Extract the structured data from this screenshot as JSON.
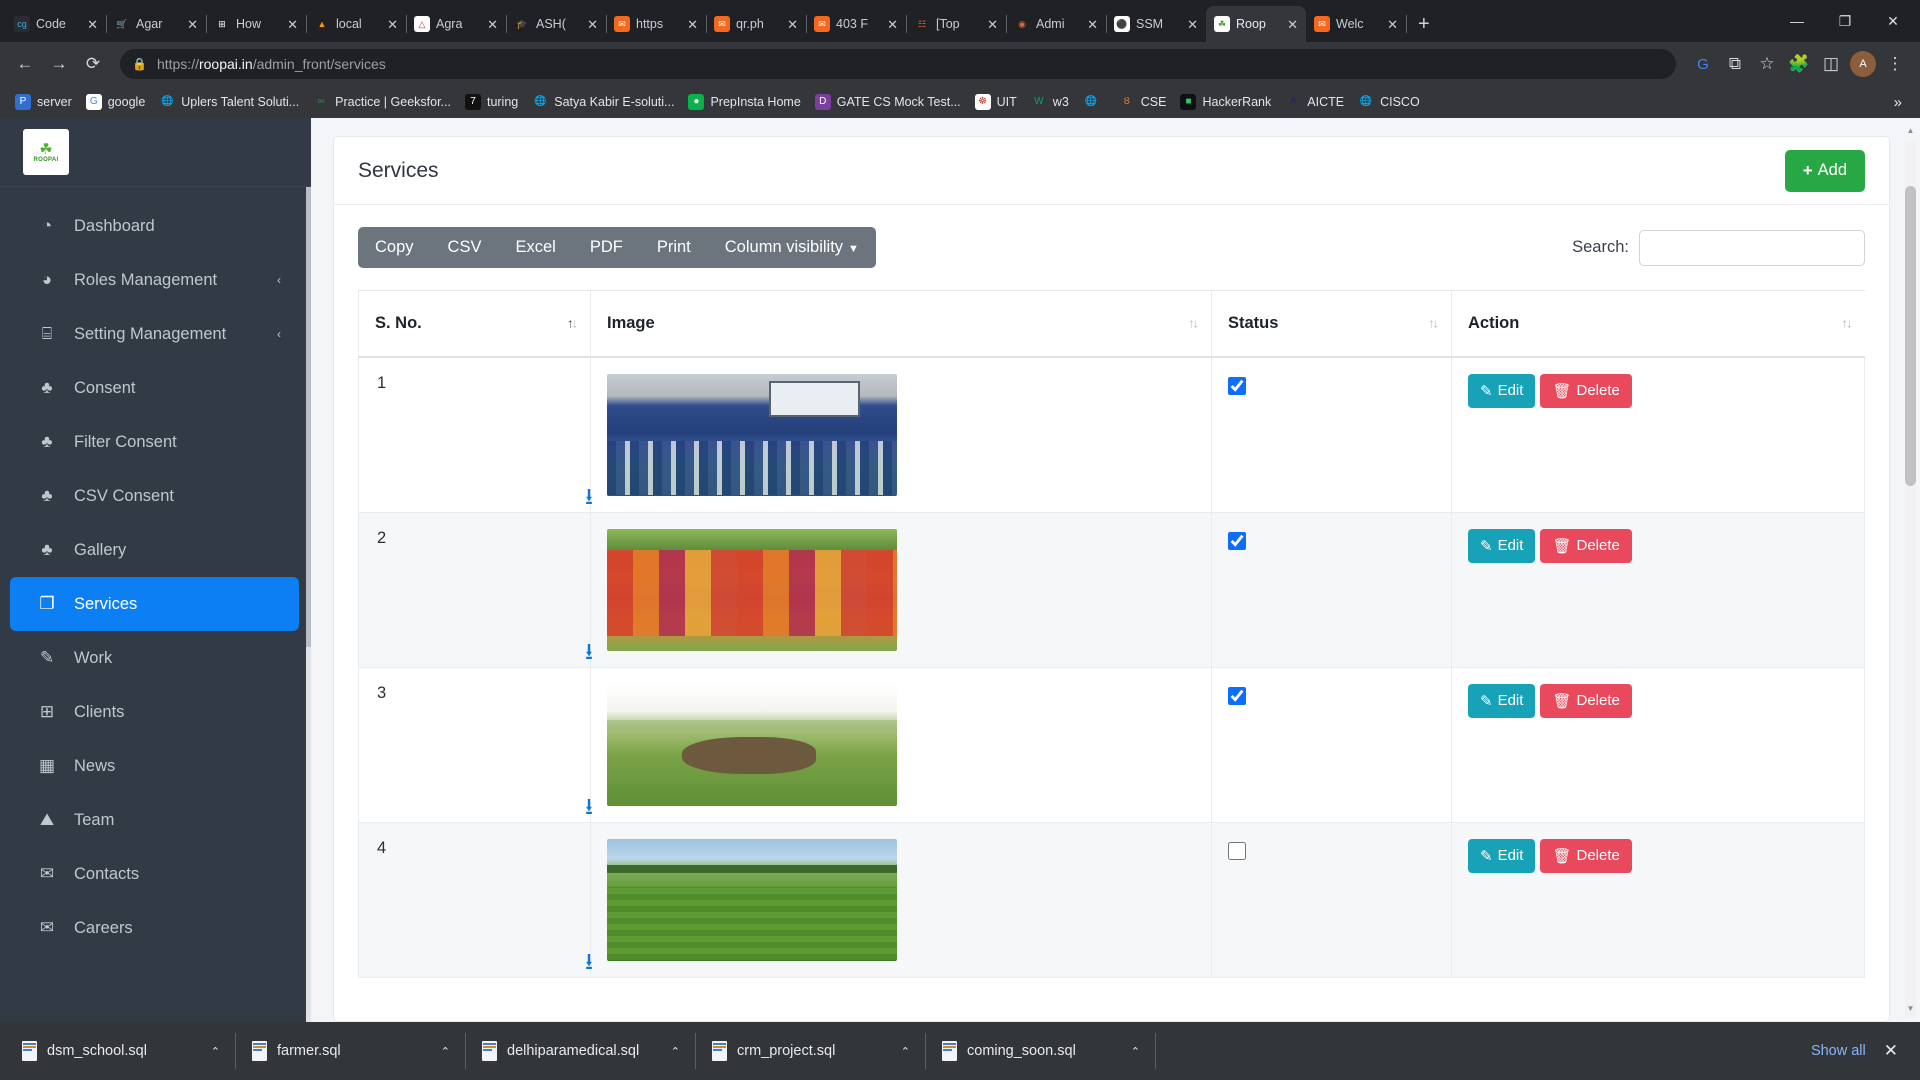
{
  "browser": {
    "tabs": [
      {
        "label": "Code",
        "icon": "cg-icon",
        "active": false
      },
      {
        "label": "Agar",
        "icon": "cart-icon",
        "active": false
      },
      {
        "label": "How",
        "icon": "microsoft-icon",
        "active": false
      },
      {
        "label": "local",
        "icon": "pma-icon",
        "active": false
      },
      {
        "label": "Agra",
        "icon": "agra-icon",
        "active": false
      },
      {
        "label": "ASH(",
        "icon": "graduation-cap-icon",
        "active": false
      },
      {
        "label": "https",
        "icon": "xampp-icon",
        "active": false
      },
      {
        "label": "qr.ph",
        "icon": "xampp-icon",
        "active": false
      },
      {
        "label": "403 F",
        "icon": "xampp-icon",
        "active": false
      },
      {
        "label": "[Top",
        "icon": "polrici-icon",
        "active": false
      },
      {
        "label": "Admi",
        "icon": "chrome-icon",
        "active": false
      },
      {
        "label": "SSM",
        "icon": "ssm-icon",
        "active": false
      },
      {
        "label": "Roop",
        "icon": "roopai-icon",
        "active": true
      },
      {
        "label": "Welc",
        "icon": "xampp-icon",
        "active": false
      }
    ],
    "new_tab_label": "+",
    "window_controls": {
      "minimize": "—",
      "maximize": "❐",
      "close": "✕"
    },
    "nav": {
      "back": "←",
      "forward": "→",
      "reload": "⟳",
      "lock_icon": "lock-icon"
    },
    "url": {
      "scheme": "https://",
      "host": "roopai.in",
      "path": "/admin_front/services"
    },
    "right_icons": [
      "google-g-icon",
      "share-icon",
      "bookmark-star-icon",
      "extensions-puzzle-icon",
      "sidepanel-icon",
      "profile-avatar",
      "kebab-menu-icon"
    ],
    "profile_initial": "A",
    "bookmarks": [
      {
        "label": "server",
        "icon": "p-icon"
      },
      {
        "label": "google",
        "icon": "google-g-icon"
      },
      {
        "label": "Uplers Talent Soluti...",
        "icon": "globe-icon"
      },
      {
        "label": "Practice | Geeksfor...",
        "icon": "geeksforgeeks-icon"
      },
      {
        "label": "turing",
        "icon": "turing-icon"
      },
      {
        "label": "Satya Kabir E-soluti...",
        "icon": "globe-icon"
      },
      {
        "label": "PrepInsta Home",
        "icon": "prepinsta-icon"
      },
      {
        "label": "GATE CS Mock Test...",
        "icon": "gate-icon"
      },
      {
        "label": "UIT",
        "icon": "uit-icon"
      },
      {
        "label": "w3",
        "icon": "w3schools-icon"
      },
      {
        "label": "",
        "icon": "globe-icon"
      },
      {
        "label": "CSE",
        "icon": "cse-icon"
      },
      {
        "label": "HackerRank",
        "icon": "hackerrank-icon"
      },
      {
        "label": "AICTE",
        "icon": "aicte-icon"
      },
      {
        "label": "CISCO",
        "icon": "globe-icon"
      }
    ],
    "bookmarks_overflow": "»"
  },
  "sidebar": {
    "brand": {
      "mark": "☘",
      "text": "ROOPAI"
    },
    "items": [
      {
        "label": "Dashboard",
        "icon": "dashboard-gauge-icon",
        "caret": "",
        "active": false
      },
      {
        "label": "Roles Management",
        "icon": "pie-chart-icon",
        "caret": "‹",
        "active": false
      },
      {
        "label": "Setting Management",
        "icon": "grid-icon",
        "caret": "‹",
        "active": false
      },
      {
        "label": "Consent",
        "icon": "tree-icon",
        "caret": "",
        "active": false
      },
      {
        "label": "Filter Consent",
        "icon": "tree-icon",
        "caret": "",
        "active": false
      },
      {
        "label": "CSV Consent",
        "icon": "tree-icon",
        "caret": "",
        "active": false
      },
      {
        "label": "Gallery",
        "icon": "tree-icon",
        "caret": "",
        "active": false
      },
      {
        "label": "Services",
        "icon": "copy-files-icon",
        "caret": "",
        "active": true
      },
      {
        "label": "Work",
        "icon": "edit-square-icon",
        "caret": "",
        "active": false
      },
      {
        "label": "Clients",
        "icon": "plus-square-icon",
        "caret": "",
        "active": false
      },
      {
        "label": "News",
        "icon": "table-icon",
        "caret": "",
        "active": false
      },
      {
        "label": "Team",
        "icon": "image-icon",
        "caret": "",
        "active": false
      },
      {
        "label": "Contacts",
        "icon": "envelope-icon",
        "caret": "",
        "active": false
      },
      {
        "label": "Careers",
        "icon": "envelope-icon",
        "caret": "",
        "active": false
      }
    ]
  },
  "main": {
    "page_title": "Services",
    "add_button": {
      "label": "Add",
      "plus": "+",
      "color": "#28a745"
    },
    "datatable": {
      "buttons": [
        "Copy",
        "CSV",
        "Excel",
        "PDF",
        "Print"
      ],
      "column_visibility": "Column visibility",
      "search_label": "Search:",
      "search_value": "",
      "search_placeholder": "",
      "columns": [
        "S. No.",
        "Image",
        "Status",
        "Action"
      ],
      "rows": [
        {
          "sno": "1",
          "image": "classroom-session-photo",
          "status_checked": true,
          "edit": "Edit",
          "delete": "Delete",
          "download_icon": "download-icon"
        },
        {
          "sno": "2",
          "image": "women-group-photo",
          "status_checked": true,
          "edit": "Edit",
          "delete": "Delete",
          "download_icon": "download-icon"
        },
        {
          "sno": "3",
          "image": "cattle-field-photo",
          "status_checked": true,
          "edit": "Edit",
          "delete": "Delete",
          "download_icon": "download-icon"
        },
        {
          "sno": "4",
          "image": "green-farm-field-photo",
          "status_checked": false,
          "edit": "Edit",
          "delete": "Delete",
          "download_icon": "download-icon"
        }
      ]
    }
  },
  "download_shelf": {
    "items": [
      {
        "name": "dsm_school.sql",
        "caret": "⌃"
      },
      {
        "name": "farmer.sql",
        "caret": "⌃"
      },
      {
        "name": "delhiparamedical.sql",
        "caret": "⌃"
      },
      {
        "name": "crm_project.sql",
        "caret": "⌃"
      },
      {
        "name": "coming_soon.sql",
        "caret": "⌃"
      }
    ],
    "show_all": "Show all",
    "close": "✕"
  }
}
